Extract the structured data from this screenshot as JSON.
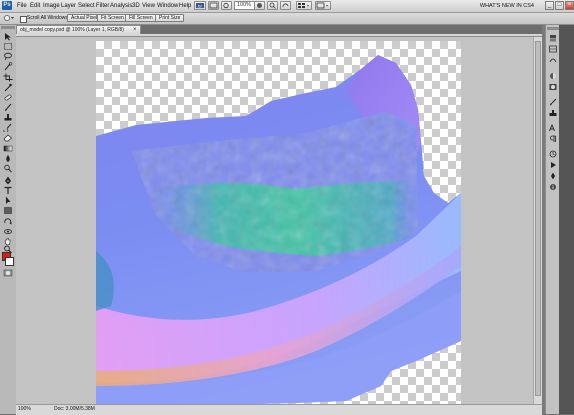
{
  "app": {
    "logo": "Ps",
    "menu": [
      "File",
      "Edit",
      "Image",
      "Layer",
      "Select",
      "Filter",
      "Analysis",
      "3D",
      "View",
      "Window",
      "Help"
    ],
    "zoom_display": "100%",
    "whats_new": "WHAT'S NEW IN CS4",
    "window_controls": [
      "_",
      "□",
      "×"
    ]
  },
  "options_bar": {
    "scroll_all_windows": "Scroll All Windows",
    "buttons": [
      "Actual Pixels",
      "Fit Screen",
      "Fill Screen",
      "Print Size"
    ]
  },
  "document": {
    "title": "obj_model copy.psd @ 100% (Layer 1, RGB/8)",
    "close": "×"
  },
  "status": {
    "zoom": "100%",
    "doc": "Doc: 3.00M/5.38M"
  },
  "colors": {
    "foreground": "#e21b12",
    "background": "#ffffff"
  },
  "tools": [
    "move-icon",
    "marquee-icon",
    "lasso-icon",
    "quick-select-icon",
    "crop-icon",
    "eyedropper-icon",
    "healing-icon",
    "brush-icon",
    "clone-stamp-icon",
    "history-brush-icon",
    "eraser-icon",
    "gradient-icon",
    "blur-icon",
    "dodge-icon",
    "pen-icon",
    "type-icon",
    "path-select-icon",
    "shape-icon",
    "3d-rotate-icon",
    "3d-orbit-icon",
    "hand-icon",
    "zoom-icon"
  ],
  "dock_icons": [
    "layers-icon",
    "channels-icon",
    "paths-icon",
    "adjustments-icon",
    "masks-icon",
    "brushes-icon",
    "clone-source-icon",
    "character-icon",
    "paragraph-icon",
    "history-icon",
    "actions-icon",
    "navigator-icon",
    "info-icon"
  ]
}
